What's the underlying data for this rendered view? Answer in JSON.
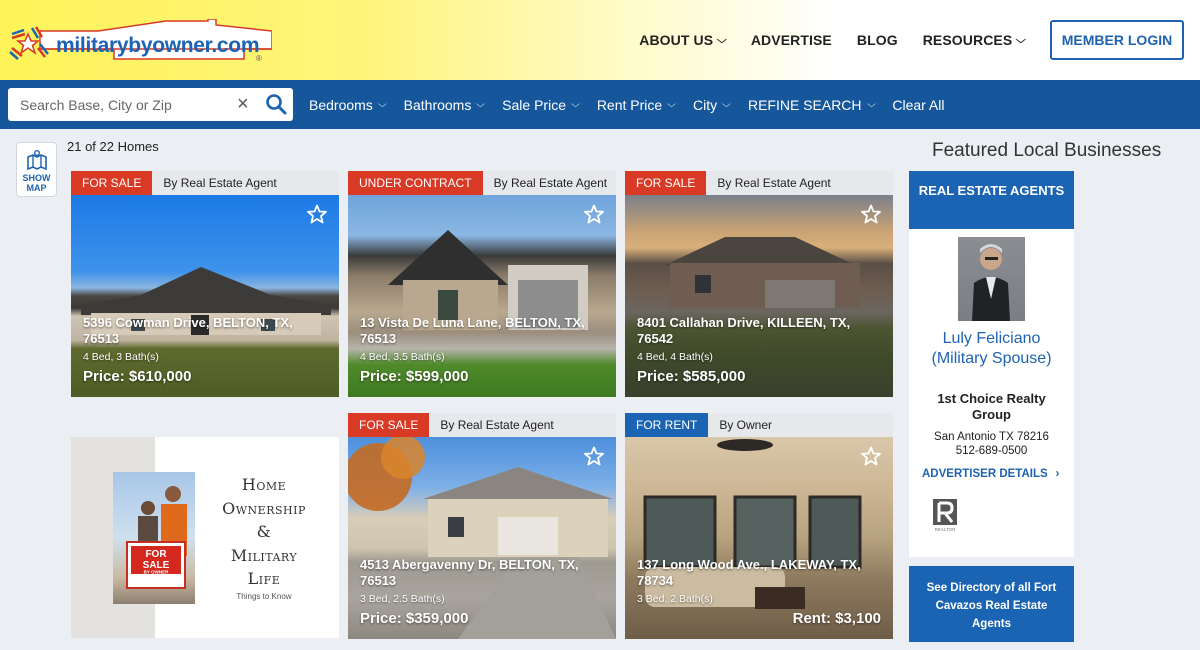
{
  "header": {
    "logo_text": "militarybyowner.com",
    "logo_reg": "®",
    "nav": [
      {
        "label": "ABOUT US",
        "has_dropdown": true
      },
      {
        "label": "ADVERTISE",
        "has_dropdown": false
      },
      {
        "label": "BLOG",
        "has_dropdown": false
      },
      {
        "label": "RESOURCES",
        "has_dropdown": true
      }
    ],
    "login_label": "MEMBER LOGIN",
    "chevron": "⌄"
  },
  "filterbar": {
    "search_placeholder": "Search Base, City or Zip",
    "search_value": "",
    "clear_glyph": "×",
    "filters": [
      {
        "label": "Bedrooms"
      },
      {
        "label": "Bathrooms"
      },
      {
        "label": "Sale Price"
      },
      {
        "label": "Rent Price"
      },
      {
        "label": "City"
      },
      {
        "label": "REFINE SEARCH"
      }
    ],
    "clear_all_label": "Clear All"
  },
  "results": {
    "count_label": "21 of 22 Homes",
    "show_map_line1": "SHOW",
    "show_map_line2": "MAP"
  },
  "listings": [
    {
      "status": "FOR SALE",
      "status_type": "sale",
      "by": "By Real Estate Agent",
      "address": "5396 Cowman Drive, BELTON, TX, 76513",
      "beds_baths": "4 Bed,  3 Bath(s)",
      "price": "Price: $610,000"
    },
    {
      "status": "UNDER CONTRACT",
      "status_type": "sale",
      "by": "By Real Estate Agent",
      "address": "13 Vista De Luna Lane, BELTON, TX, 76513",
      "beds_baths": "4 Bed,  3.5 Bath(s)",
      "price": "Price: $599,000"
    },
    {
      "status": "FOR SALE",
      "status_type": "sale",
      "by": "By Real Estate Agent",
      "address": "8401 Callahan Drive, KILLEEN, TX, 76542",
      "beds_baths": "4 Bed,  4 Bath(s)",
      "price": "Price: $585,000"
    },
    {
      "status": "FOR SALE",
      "status_type": "sale",
      "by": "By Real Estate Agent",
      "address": "4513 Abergavenny Dr, BELTON, TX, 76513",
      "beds_baths": "3 Bed,  2.5 Bath(s)",
      "price": "Price: $359,000"
    },
    {
      "status": "FOR RENT",
      "status_type": "rent",
      "by": "By Owner",
      "address": "137 Long Wood Ave., LAKEWAY, TX, 78734",
      "beds_baths": "3 Bed,  2 Bath(s)",
      "price": "Rent: $3,100"
    }
  ],
  "article": {
    "title_lines": [
      "Home",
      "Ownership",
      "&",
      "Military",
      "Life"
    ],
    "subtitle": "Things to Know",
    "sign_line1": "FOR",
    "sign_line2": "SALE",
    "sign_line3": "BY OWNER"
  },
  "sidebar": {
    "featured_title": "Featured Local Businesses",
    "category_label": "REAL ESTATE AGENTS",
    "agent_name_line1": "Luly Feliciano",
    "agent_name_line2": "(Military Spouse)",
    "company_line1": "1st Choice Realty",
    "company_line2": "Group",
    "city_state_zip": "San Antonio  TX  78216",
    "phone": "512-689-0500",
    "details_label": "ADVERTISER DETAILS",
    "details_chevron": "›",
    "realtor_label": "REALTOR",
    "directory_label": "See Directory of all Fort Cavazos  Real Estate Agents"
  },
  "colors": {
    "brand_blue": "#16579b",
    "accent_blue": "#1b64b3",
    "sale_red": "#d93a26",
    "header_yellow": "#fff35a"
  }
}
